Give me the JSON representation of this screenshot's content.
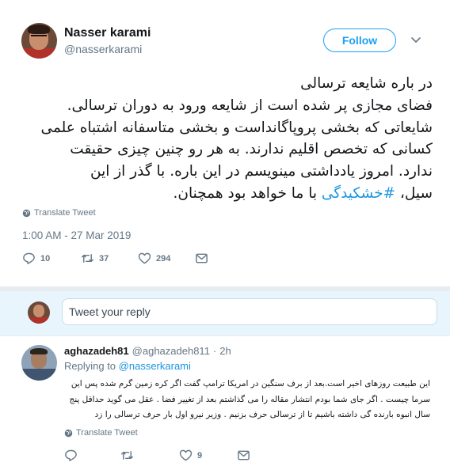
{
  "tweet": {
    "author_name": "Nasser karami",
    "author_handle": "@nasserkarami",
    "follow_label": "Follow",
    "text_before_hashtag": "در باره شایعه ترسالی\nفضای مجازی پر شده است از شایعه ورود به دوران ترسالی.\nشایعاتی که بخشی پروپاگانداست و بخشی متاسفانه اشتباه علمی\nکسانی که تخصص اقلیم ندارند. به هر رو چنین چیزی حقیقت\nندارد. امروز یادداشتی مینویسم در این باره. با گذر از این\nسیل، ",
    "hashtag": "#خشکیدگی",
    "text_after_hashtag": " با ما خواهد بود همچنان.",
    "translate_label": "Translate Tweet",
    "timestamp": "1:00 AM - 27 Mar 2019",
    "reply_count": "10",
    "retweet_count": "37",
    "like_count": "294"
  },
  "reply_box": {
    "placeholder": "Tweet your reply"
  },
  "reply": {
    "author_name": "aghazadeh81",
    "author_handle": "@aghazadeh811",
    "dot": "·",
    "time": "2h",
    "replying_to_label": "Replying to",
    "replying_to_mention": "@nasserkarami",
    "text": "این طبیعت روزهای اخیر است.بعد از برف سنگین در امریکا ترامپ گفت اگر کره زمین گرم شده پس این سرما چیست . اگر جای شما بودم انتشار مقاله را می گذاشتم بعد از تغییر فضا . عقل می گوید حداقل پنج سال انبوه بارنده گی داشته باشیم تا از ترسالی حرف بزنیم . وزیر نیرو اول بار حرف ترسالی را زد",
    "translate_label": "Translate Tweet",
    "like_count": "9"
  },
  "icons": {
    "follow_chevron": "chevron-down-icon",
    "translate": "globe-icon",
    "reply": "reply-icon",
    "retweet": "retweet-icon",
    "like": "heart-icon",
    "message": "envelope-icon"
  },
  "colors": {
    "accent": "#1da1f2",
    "link": "#1b95e0",
    "secondary_text": "#657786",
    "reply_box_bg": "#e8f5fd"
  }
}
